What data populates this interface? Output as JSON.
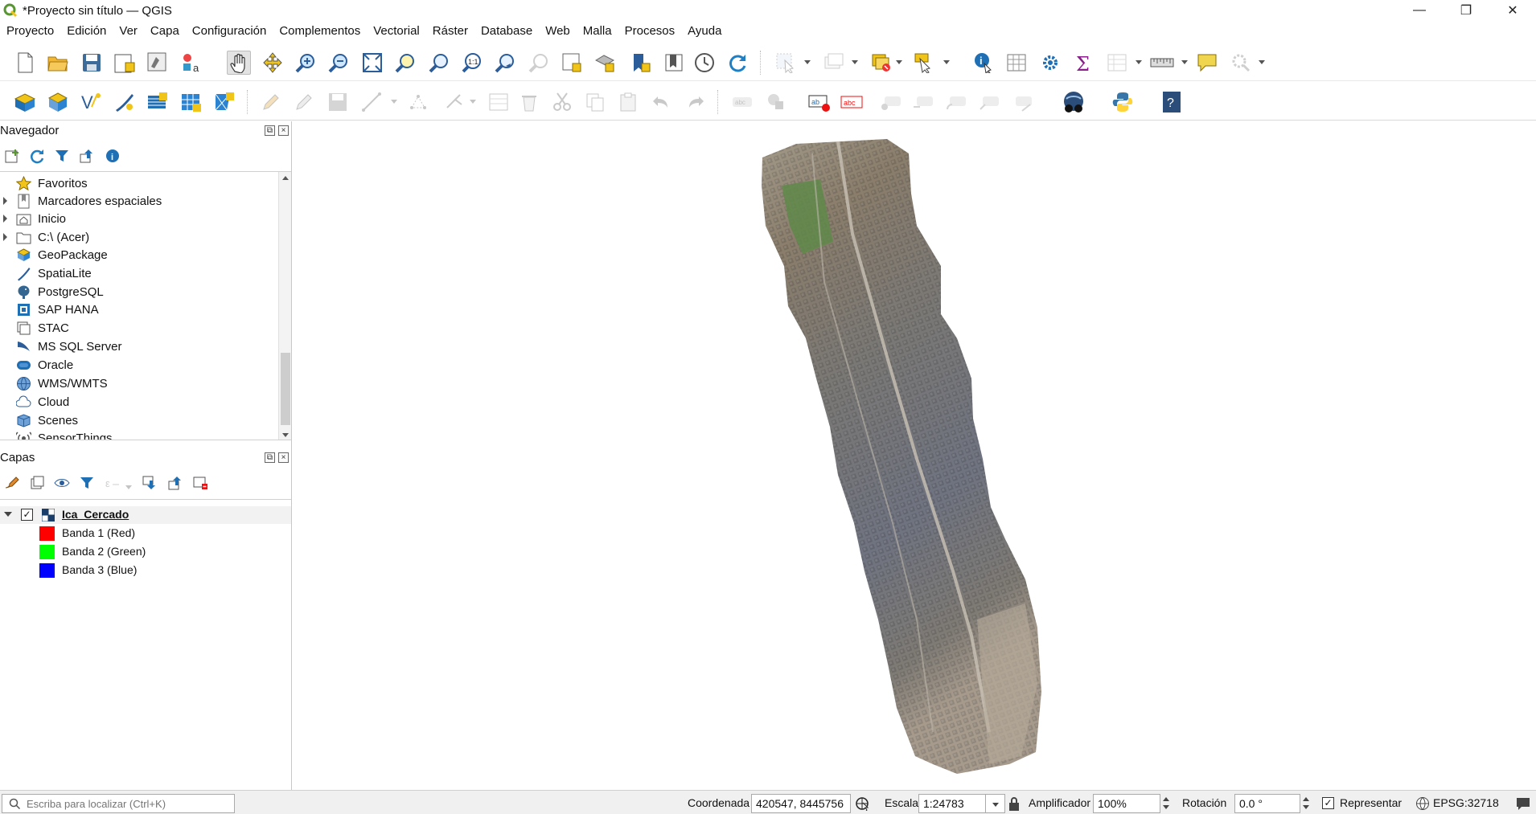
{
  "window": {
    "title": "*Proyecto sin título — QGIS",
    "controls": [
      "—",
      "❐",
      "✕"
    ]
  },
  "menu": [
    "Proyecto",
    "Edición",
    "Ver",
    "Capa",
    "Configuración",
    "Complementos",
    "Vectorial",
    "Ráster",
    "Database",
    "Web",
    "Malla",
    "Procesos",
    "Ayuda"
  ],
  "toolbar1": {
    "icons": [
      "new-project-icon",
      "open-project-icon",
      "save-project-icon",
      "new-print-layout-icon",
      "style-manager-icon",
      "text-annotation-icon",
      "pan-icon",
      "pan-to-selection-icon",
      "zoom-in-icon",
      "zoom-out-icon",
      "zoom-full-icon",
      "zoom-to-selection-icon",
      "zoom-to-layer-icon",
      "zoom-native-icon",
      "zoom-last-icon",
      "zoom-next-icon",
      "new-map-view-icon",
      "new-3d-view-icon",
      "new-bookmark-icon",
      "show-bookmarks-icon",
      "temporal-controller-icon",
      "refresh-icon",
      "select-features-icon",
      "deselect-icon",
      "select-by-expression-icon",
      "identify-icon",
      "attribute-table-icon",
      "processing-toolbox-icon",
      "statistics-icon",
      "field-calculator-icon",
      "measure-icon",
      "map-tips-icon",
      "locator-settings-icon"
    ]
  },
  "toolbar2": {
    "icons": [
      "data-source-manager-icon",
      "new-geopackage-layer-icon",
      "new-shapefile-layer-icon",
      "new-spatialite-layer-icon",
      "new-virtual-layer-icon",
      "new-temporary-layer-icon",
      "new-mesh-layer-icon",
      "edit-pencil-icon",
      "toggle-editing-icon",
      "save-edits-icon",
      "digitize-icon",
      "vertex-tool-icon",
      "node-tool-icon",
      "modify-attributes-icon",
      "delete-selected-icon",
      "cut-icon",
      "copy-icon",
      "paste-icon",
      "undo-icon",
      "redo-icon",
      "label-icon",
      "label-pin-icon",
      "label-highlight-icon",
      "label-red-icon",
      "label-show-hide-icon",
      "label-move-icon",
      "label-rotate-icon",
      "label-change-icon",
      "label-rubber-icon",
      "georeferencer-icon",
      "python-icon",
      "help-icon"
    ]
  },
  "browser_panel": {
    "title": "Navegador",
    "items": [
      {
        "label": "Favoritos",
        "icon": "star-icon",
        "expandable": false
      },
      {
        "label": "Marcadores espaciales",
        "icon": "bookmarks-icon",
        "expandable": true
      },
      {
        "label": "Inicio",
        "icon": "home-folder-icon",
        "expandable": true
      },
      {
        "label": "C:\\ (Acer)",
        "icon": "drive-folder-icon",
        "expandable": true
      },
      {
        "label": "GeoPackage",
        "icon": "geopackage-icon",
        "expandable": false
      },
      {
        "label": "SpatiaLite",
        "icon": "spatialite-icon",
        "expandable": false
      },
      {
        "label": "PostgreSQL",
        "icon": "postgresql-icon",
        "expandable": false
      },
      {
        "label": "SAP HANA",
        "icon": "sap-hana-icon",
        "expandable": false
      },
      {
        "label": "STAC",
        "icon": "stac-icon",
        "expandable": false
      },
      {
        "label": "MS SQL Server",
        "icon": "mssql-icon",
        "expandable": false
      },
      {
        "label": "Oracle",
        "icon": "oracle-icon",
        "expandable": false
      },
      {
        "label": "WMS/WMTS",
        "icon": "wms-icon",
        "expandable": false
      },
      {
        "label": "Cloud",
        "icon": "cloud-icon",
        "expandable": false
      },
      {
        "label": "Scenes",
        "icon": "scenes-icon",
        "expandable": false
      },
      {
        "label": "SensorThings",
        "icon": "sensorthings-icon",
        "expandable": false
      }
    ]
  },
  "layers_panel": {
    "title": "Capas",
    "layer": {
      "name": "Ica_Cercado",
      "checked": true
    },
    "bands": [
      {
        "label": "Banda 1 (Red)",
        "color": "#ff0000"
      },
      {
        "label": "Banda 2 (Green)",
        "color": "#00ff00"
      },
      {
        "label": "Banda 3 (Blue)",
        "color": "#0000ff"
      }
    ]
  },
  "statusbar": {
    "locator_placeholder": "Escriba para localizar (Ctrl+K)",
    "coord_label": "Coordenada",
    "coord_value": "420547, 8445756",
    "scale_label": "Escala",
    "scale_value": "1:24783",
    "magnifier_label": "Amplificador",
    "magnifier_value": "100%",
    "rotation_label": "Rotación",
    "rotation_value": "0.0 °",
    "render_label": "Representar",
    "render_checked": true,
    "crs": "EPSG:32718"
  },
  "colors": {
    "qgis_green": "#589632",
    "qgis_yellow": "#f0c419",
    "accent_blue": "#1f6fb5"
  }
}
